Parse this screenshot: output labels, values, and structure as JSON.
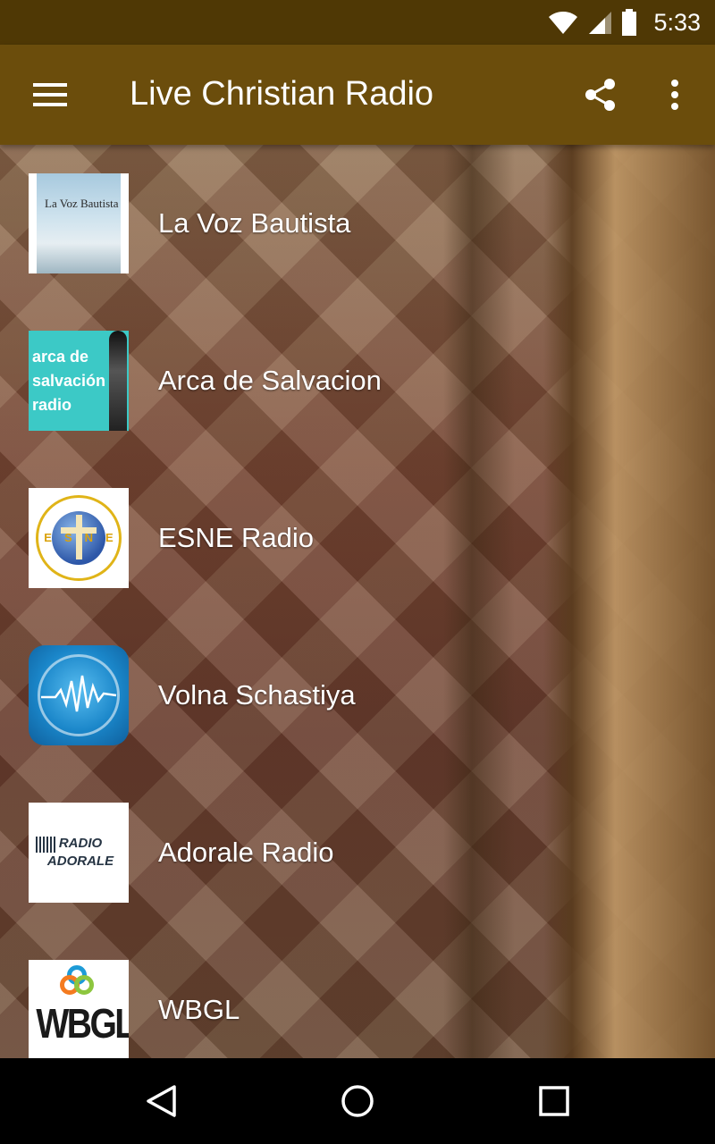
{
  "status_bar": {
    "time": "5:33",
    "icons": [
      "wifi-icon",
      "cell-signal-icon",
      "battery-icon"
    ]
  },
  "app_bar": {
    "title": "Live Christian Radio",
    "background_color": "#6b4d0c",
    "status_color": "#4f3805",
    "icons": [
      "menu-icon",
      "share-icon",
      "more-vert-icon"
    ]
  },
  "stations": [
    {
      "name": "La Voz Bautista",
      "logo_text": "La Voz Bautista"
    },
    {
      "name": "Arca de Salvacion",
      "logo_text": "arca de salvación radio"
    },
    {
      "name": "ESNE Radio",
      "logo_text": "ESNE"
    },
    {
      "name": "Volna Schastiya",
      "logo_text": ""
    },
    {
      "name": "Adorale Radio",
      "logo_text": "RADIO ADORALE"
    },
    {
      "name": "WBGL",
      "logo_text": "WBGL"
    }
  ],
  "nav_bar": {
    "icons": [
      "back-icon",
      "home-icon",
      "recents-icon"
    ]
  }
}
